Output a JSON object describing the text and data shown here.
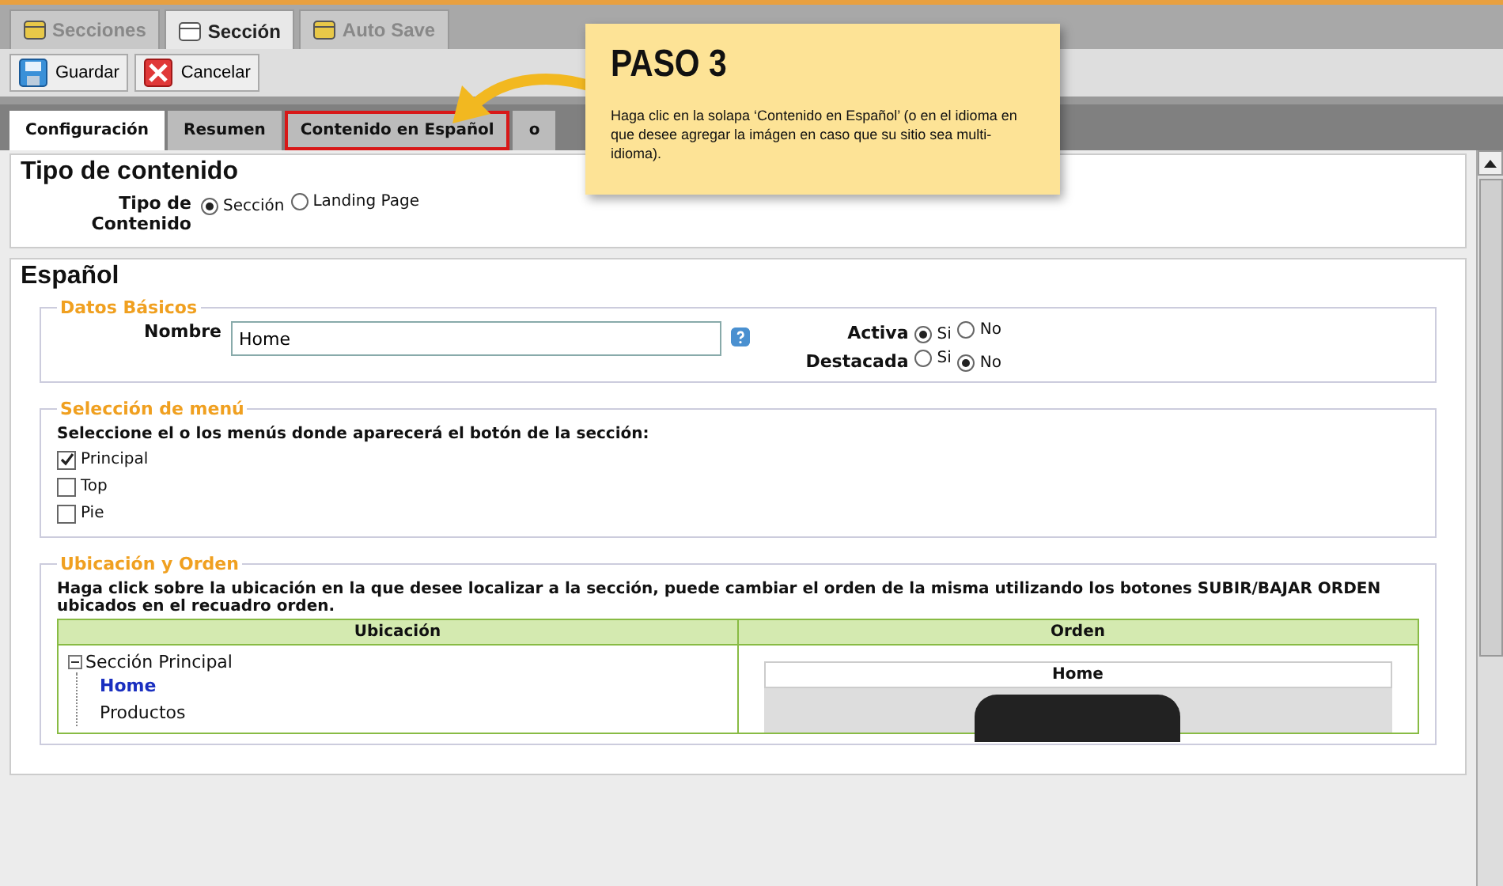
{
  "top_tabs": [
    {
      "label": "Secciones",
      "selected": false,
      "kind": "folder"
    },
    {
      "label": "Sección",
      "selected": true,
      "kind": "page"
    },
    {
      "label": "Auto Save",
      "selected": false,
      "kind": "folder"
    }
  ],
  "toolbar": {
    "buttons": [
      {
        "label": "Guardar",
        "kind": "save"
      },
      {
        "label": "Cancelar",
        "kind": "cancel"
      }
    ]
  },
  "content_tabs": [
    {
      "label": "Configuración",
      "selected": true,
      "highlighted": false
    },
    {
      "label": "Resumen",
      "selected": false,
      "highlighted": false
    },
    {
      "label": "Contenido en Español",
      "selected": false,
      "highlighted": true
    },
    {
      "label": "o",
      "selected": false,
      "highlighted": false
    }
  ],
  "callout": {
    "title": "PASO 3",
    "text": "Haga clic en la solapa ‘Contenido en Español’ (o en el idioma en que desee agregar la imágen en caso que su sitio sea multi-idioma)."
  },
  "tipo_contenido": {
    "title": "Tipo de contenido",
    "field_label": "Tipo de Contenido",
    "options": [
      {
        "label": "Sección",
        "selected": true
      },
      {
        "label": "Landing Page",
        "selected": false
      }
    ]
  },
  "espanol": {
    "title": "Español",
    "datos_basicos": {
      "legend": "Datos Básicos",
      "nombre_label": "Nombre",
      "nombre_value": "Home",
      "flags": [
        {
          "label": "Activa",
          "options": [
            {
              "label": "Si",
              "selected": true
            },
            {
              "label": "No",
              "selected": false
            }
          ]
        },
        {
          "label": "Destacada",
          "options": [
            {
              "label": "Si",
              "selected": false
            },
            {
              "label": "No",
              "selected": true
            }
          ]
        }
      ]
    },
    "seleccion_menu": {
      "legend": "Selección de menú",
      "instruction": "Seleccione el o los menús donde aparecerá el botón de la sección:",
      "items": [
        {
          "label": "Principal",
          "checked": true
        },
        {
          "label": "Top",
          "checked": false
        },
        {
          "label": "Pie",
          "checked": false
        }
      ]
    },
    "ubicacion": {
      "legend": "Ubicación y Orden",
      "instruction": "Haga click sobre la ubicación en la que desee localizar a la sección, puede cambiar el orden de la misma utilizando los botones SUBIR/BAJAR ORDEN ubicados en el recuadro orden.",
      "columns": [
        "Ubicación",
        "Orden"
      ],
      "tree": {
        "label": "Sección Principal",
        "expanded": true,
        "children": [
          {
            "label": "Home",
            "selected": true
          },
          {
            "label": "Productos",
            "selected": false
          }
        ]
      },
      "orden_items": [
        "Home"
      ]
    }
  }
}
